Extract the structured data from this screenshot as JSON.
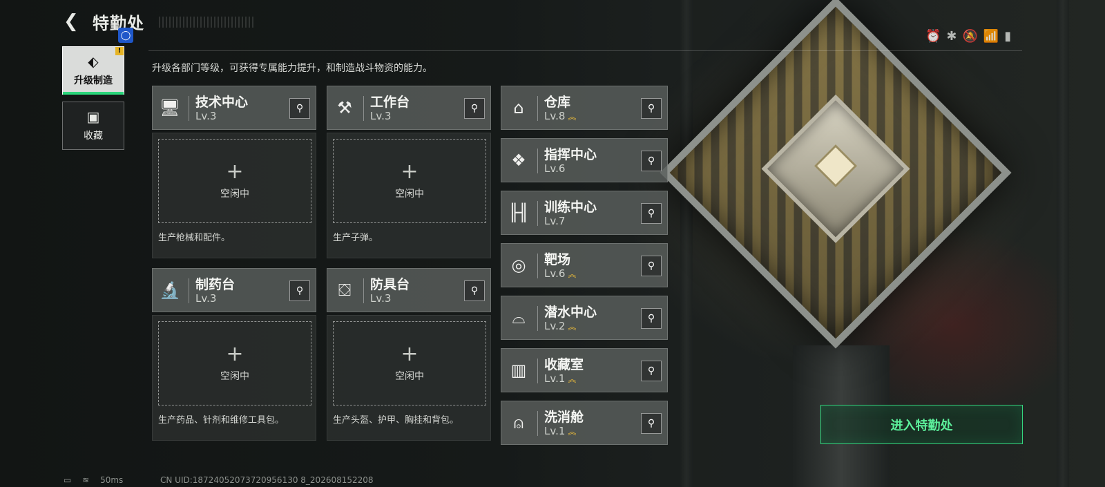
{
  "header": {
    "title": "特勤处",
    "back_icon": "back-arrow-icon"
  },
  "status_bar": {
    "icons": [
      "alarm-icon",
      "bluetooth-icon",
      "mute-icon",
      "wifi-icon",
      "signal-icon"
    ]
  },
  "sidebar": {
    "items": [
      {
        "label": "升级制造",
        "icon": "upgrade-icon",
        "active": true,
        "alert": "!"
      },
      {
        "label": "收藏",
        "icon": "collection-icon",
        "active": false
      }
    ]
  },
  "description": "升级各部门等级，可获得专属能力提升，和制造战斗物资的能力。",
  "production_cards": [
    {
      "name": "技术中心",
      "level": "Lv.3",
      "icon": "computer-icon",
      "slot_status": "空闲中",
      "produces": "生产枪械和配件。"
    },
    {
      "name": "工作台",
      "level": "Lv.3",
      "icon": "tools-icon",
      "slot_status": "空闲中",
      "produces": "生产子弹。"
    },
    {
      "name": "制药台",
      "level": "Lv.3",
      "icon": "microscope-icon",
      "slot_status": "空闲中",
      "produces": "生产药品、针剂和维修工具包。"
    },
    {
      "name": "防具台",
      "level": "Lv.3",
      "icon": "armor-icon",
      "slot_status": "空闲中",
      "produces": "生产头盔、护甲、胸挂和背包。"
    }
  ],
  "departments": [
    {
      "name": "仓库",
      "level": "Lv.8",
      "upgradable": true,
      "icon": "warehouse-icon"
    },
    {
      "name": "指挥中心",
      "level": "Lv.6",
      "upgradable": false,
      "icon": "command-chip-icon"
    },
    {
      "name": "训练中心",
      "level": "Lv.7",
      "upgradable": false,
      "icon": "dumbbell-icon"
    },
    {
      "name": "靶场",
      "level": "Lv.6",
      "upgradable": true,
      "icon": "target-icon"
    },
    {
      "name": "潜水中心",
      "level": "Lv.2",
      "upgradable": true,
      "icon": "diving-mask-icon"
    },
    {
      "name": "收藏室",
      "level": "Lv.1",
      "upgradable": true,
      "icon": "display-case-icon"
    },
    {
      "name": "洗消舱",
      "level": "Lv.1",
      "upgradable": true,
      "icon": "decon-chamber-icon"
    }
  ],
  "enter_button": "进入特勤处",
  "footer": {
    "ping": "50ms",
    "uid": "CN UID:18724052073720956130 8_202608152208"
  },
  "colors": {
    "accent_green": "#35d57f",
    "upgrade_gold": "#e6b83a",
    "hint_blue": "#1f57c9"
  }
}
